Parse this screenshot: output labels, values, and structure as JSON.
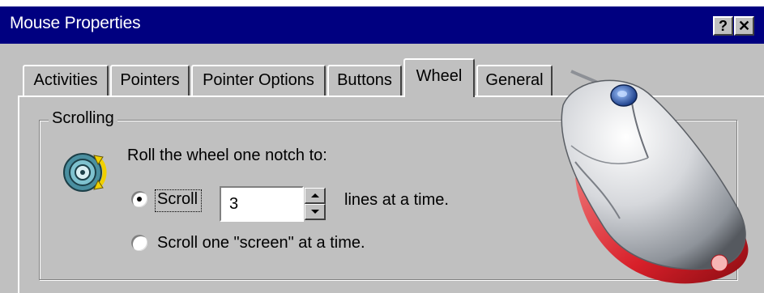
{
  "window": {
    "title": "Mouse Properties"
  },
  "title_buttons": {
    "help": "?",
    "close": "✕"
  },
  "tabs": [
    {
      "label": "Activities",
      "active": false
    },
    {
      "label": "Pointers",
      "active": false
    },
    {
      "label": "Pointer Options",
      "active": false
    },
    {
      "label": "Buttons",
      "active": false
    },
    {
      "label": "Wheel",
      "active": true
    },
    {
      "label": "General",
      "active": false
    }
  ],
  "scrolling": {
    "group_label": "Scrolling",
    "instruction": "Roll the wheel one notch to:",
    "option_scroll_label": "Scroll",
    "lines_value": "3",
    "lines_suffix": "lines at a time.",
    "option_screen_label": "Scroll one \"screen\" at a time.",
    "selected_option": "scroll"
  },
  "icons": {
    "wheel": "mouse-wheel-scroll-icon",
    "mouse": "mouse-illustration",
    "spin_up": "arrow-up-icon",
    "spin_down": "arrow-down-icon"
  },
  "colors": {
    "titlebar": "#000080",
    "face": "#c0c0c0",
    "mouse_accent": "#d8202a"
  }
}
